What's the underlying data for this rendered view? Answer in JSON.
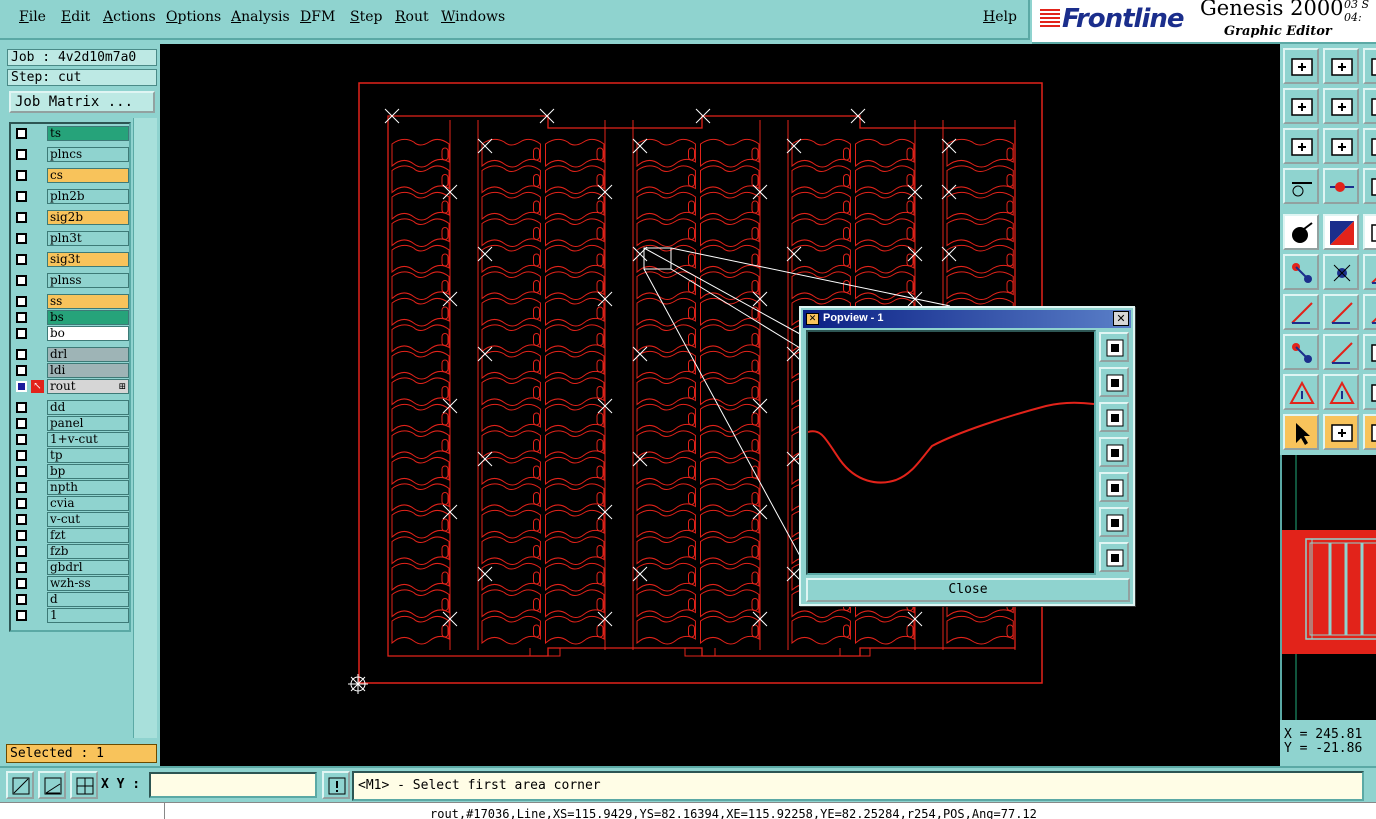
{
  "menu": {
    "items": [
      "File",
      "Edit",
      "Actions",
      "Options",
      "Analysis",
      "DFM",
      "Step",
      "Rout",
      "Windows"
    ],
    "help": "Help"
  },
  "brand": {
    "logo": "Frontline",
    "product": "Genesis 2000",
    "subtitle": "Graphic Editor",
    "date_line1": "03 S",
    "date_line2": "04:"
  },
  "job": {
    "job_label": "Job : 4v2d10m7a0",
    "step_label": "Step: cut",
    "job_matrix_button": "Job Matrix ..."
  },
  "layers": [
    {
      "name": "ts",
      "color": "#26a37a"
    },
    {
      "name": "plncs",
      "color": "#8fd3cf"
    },
    {
      "name": "cs",
      "color": "#f8c35b"
    },
    {
      "name": "pln2b",
      "color": "#8fd3cf"
    },
    {
      "name": "sig2b",
      "color": "#f8c35b"
    },
    {
      "name": "pln3t",
      "color": "#8fd3cf"
    },
    {
      "name": "sig3t",
      "color": "#f8c35b"
    },
    {
      "name": "plnss",
      "color": "#8fd3cf"
    },
    {
      "name": "ss",
      "color": "#f8c35b"
    },
    {
      "name": "bs",
      "color": "#26a37a"
    },
    {
      "name": "bo",
      "color": "#ffffff"
    },
    {
      "name": "drl",
      "color": "#9eb4b6"
    },
    {
      "name": "ldi",
      "color": "#9eb4b6"
    },
    {
      "name": "rout",
      "color": "#d6d6d6",
      "active": true
    },
    {
      "name": "dd",
      "color": "#8fd3cf"
    },
    {
      "name": "panel",
      "color": "#8fd3cf"
    },
    {
      "name": "1+v-cut",
      "color": "#8fd3cf"
    },
    {
      "name": "tp",
      "color": "#8fd3cf"
    },
    {
      "name": "bp",
      "color": "#8fd3cf"
    },
    {
      "name": "npth",
      "color": "#8fd3cf"
    },
    {
      "name": "cvia",
      "color": "#8fd3cf"
    },
    {
      "name": "v-cut",
      "color": "#8fd3cf"
    },
    {
      "name": "fzt",
      "color": "#8fd3cf"
    },
    {
      "name": "fzb",
      "color": "#8fd3cf"
    },
    {
      "name": "gbdrl",
      "color": "#8fd3cf"
    },
    {
      "name": "wzh-ss",
      "color": "#8fd3cf"
    },
    {
      "name": "d",
      "color": "#8fd3cf"
    },
    {
      "name": "1",
      "color": "#8fd3cf"
    }
  ],
  "selected": "Selected : 1",
  "popview": {
    "title": "Popview - 1",
    "close_button": "Close",
    "close_x": "✕"
  },
  "coords": {
    "x": "X = 245.81",
    "y": "Y = -21.86"
  },
  "bottom": {
    "xy_label": "X Y :",
    "xy_value": "",
    "message": "<M1> - Select first area corner"
  },
  "status": {
    "text": "rout,#17036,Line,XS=115.9429,YS=82.16394,XE=115.92258,YE=82.25284,r254,POS,Ang=77.12"
  },
  "colors": {
    "panel_bg": "#8fd3cf",
    "canvas_bg": "#000000",
    "rout_line": "#e2231a",
    "highlight": "#f8c35b"
  }
}
